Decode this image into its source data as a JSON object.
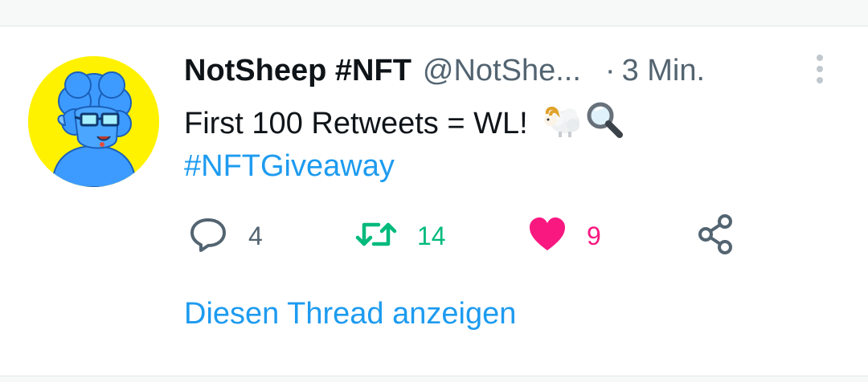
{
  "tweet": {
    "display_name": "NotSheep #NFT",
    "handle": "@NotShe...",
    "separator": "·",
    "time": "3 Min.",
    "text": "First 100 Retweets = WL!",
    "emojis": [
      "ram-emoji",
      "magnifying-glass-emoji"
    ],
    "hashtag": "#NFTGiveaway"
  },
  "actions": {
    "replies": "4",
    "retweets": "14",
    "likes": "9",
    "liked": true
  },
  "thread_link": "Diesen Thread anzeigen",
  "colors": {
    "accent": "#1d9bf0",
    "retweet": "#00ba7c",
    "like": "#f91880",
    "secondary_text": "#536471",
    "avatar_background": "#fff200",
    "avatar_character": "#3d9bff"
  },
  "icons": [
    "avatar-sheep",
    "more-vertical-icon",
    "reply-icon",
    "retweet-icon",
    "heart-icon",
    "share-icon"
  ]
}
